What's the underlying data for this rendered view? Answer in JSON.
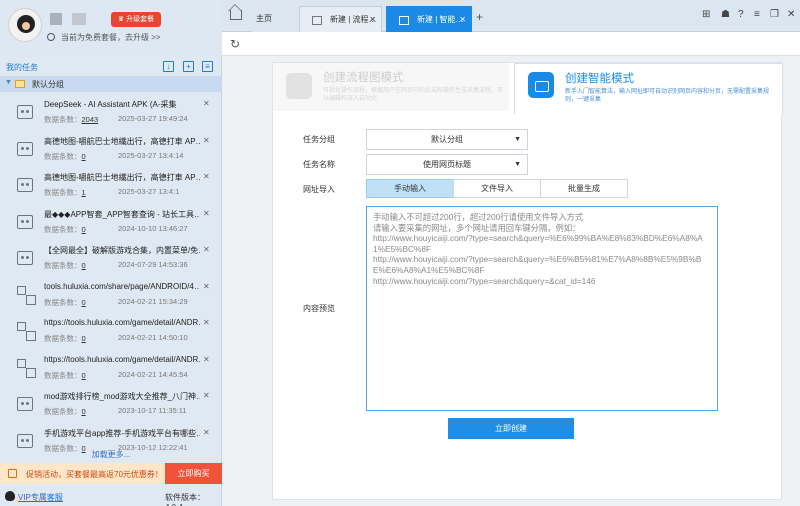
{
  "profile": {
    "upgrade_label": "升级套餐",
    "plan_text": "当前为免费套餐，去升级 >>"
  },
  "sidebar": {
    "tasks_title": "我的任务",
    "group_label": "默认分组",
    "count_label": "数据条数：",
    "tasks": [
      {
        "name": "DeepSeek - AI Assistant APK (A-采集",
        "count": "2043",
        "date": "2025-03-27 19:49:24",
        "icon": "robot-icon"
      },
      {
        "name": "高德地图-嚼航巴士地繊出行，高德打車 AP…",
        "count": "0",
        "date": "2025-03-27 13:4:14",
        "icon": "robot-icon"
      },
      {
        "name": "高德地图-嚼航巴士地繊出行，高德打車 AP…",
        "count": "1",
        "date": "2025-03-27 13:4:1",
        "icon": "robot-icon"
      },
      {
        "name": "最◆◆◆APP智套_APP智套查询 - 站长工具…",
        "count": "0",
        "date": "2024-10-10 13:46:27",
        "icon": "robot-icon"
      },
      {
        "name": "【全网最全】破解版游戏合集，内置菜单/免…",
        "count": "0",
        "date": "2024-07-29 14:53:36",
        "icon": "robot-icon"
      },
      {
        "name": "tools.huluxia.com/share/page/ANDROID/4…",
        "count": "0",
        "date": "2024-02-21 15:34:29",
        "icon": "flow-icon"
      },
      {
        "name": "https://tools.huluxia.com/game/detail/ANDR…",
        "count": "0",
        "date": "2024-02-21 14:50:10",
        "icon": "flow-icon"
      },
      {
        "name": "https://tools.huluxia.com/game/detail/ANDR…",
        "count": "0",
        "date": "2024-02-21 14:45:54",
        "icon": "flow-icon"
      },
      {
        "name": "mod游戏排行榜_mod游戏大全推荐_八门神…",
        "count": "0",
        "date": "2023-10-17 11:35:11",
        "icon": "robot-icon"
      },
      {
        "name": "手机游戏平台app推荐-手机游戏平台有哪些…",
        "count": "0",
        "date": "2023-10-12 12:22:41",
        "icon": "robot-icon"
      }
    ],
    "load_more": "加载更多...",
    "promo_text": "促销活动，买套餐最高返70元优惠券！",
    "buy_label": "立即购买",
    "vip_label": "VIP专属客服",
    "version": "软件版本：4.0.4"
  },
  "tabs": {
    "items": [
      {
        "label": "主页"
      },
      {
        "label": "新建 | 流程…"
      },
      {
        "label": "新建 | 智能…"
      }
    ]
  },
  "cards": {
    "flow": {
      "title": "创建流程图模式",
      "desc": "可视化操作流程，根据用户在网页中的点击和操作生成采集流程，可以编辑和深入自动化"
    },
    "smart": {
      "title": "创建智能模式",
      "desc": "新手入门智能算法，输入网址即可自动识别网页内容和分页，无需配置采集规则，一键采集"
    }
  },
  "form": {
    "group_label": "任务分组",
    "group_value": "默认分组",
    "name_label": "任务名称",
    "name_value": "使用网页标题",
    "import_label": "网址导入",
    "import_tabs": [
      "手动输入",
      "文件导入",
      "批量生成"
    ],
    "preview_label": "内容预览",
    "textarea_text": "手动输入不可超过200行，超过200行请使用文件导入方式\n请输入要采集的网址，多个网址请用回车键分隔，例如：\nhttp://www.houyicaiji.com/?type=search&query=%E6%99%BA%E8%83%BD%E6%A8%A1%E5%BC%8F\nhttp://www.houyicaiji.com/?type=search&query=%E6%B5%81%E7%A8%8B%E5%9B%BE%E6%A8%A1%E5%BC%8F\nhttp://www.houyicaiji.com/?type=search&query=&cat_id=146",
    "create_label": "立即创建"
  },
  "colors": {
    "accent": "#1a8ae6",
    "promo": "#f0523a"
  }
}
